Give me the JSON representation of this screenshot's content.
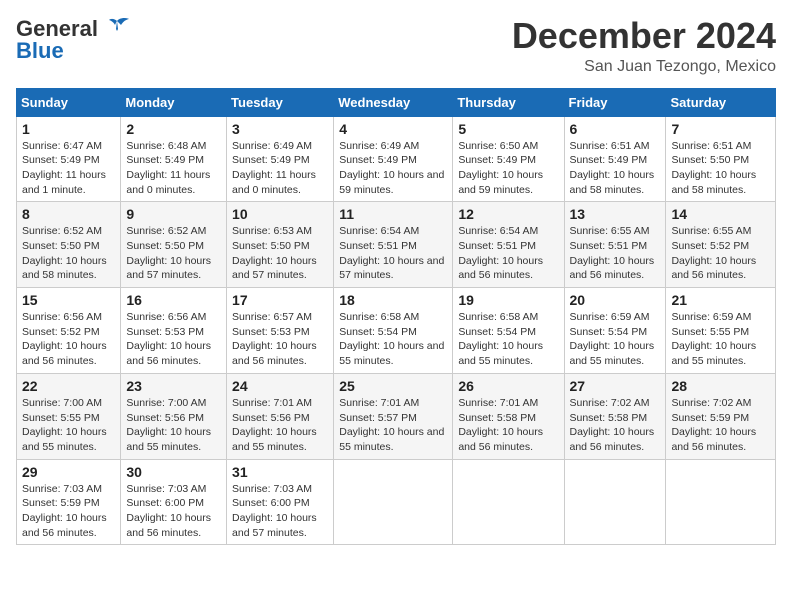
{
  "header": {
    "logo_general": "General",
    "logo_blue": "Blue",
    "month": "December 2024",
    "location": "San Juan Tezongo, Mexico"
  },
  "columns": [
    "Sunday",
    "Monday",
    "Tuesday",
    "Wednesday",
    "Thursday",
    "Friday",
    "Saturday"
  ],
  "weeks": [
    [
      {
        "day": "1",
        "sunrise": "6:47 AM",
        "sunset": "5:49 PM",
        "daylight": "11 hours and 1 minute."
      },
      {
        "day": "2",
        "sunrise": "6:48 AM",
        "sunset": "5:49 PM",
        "daylight": "11 hours and 0 minutes."
      },
      {
        "day": "3",
        "sunrise": "6:49 AM",
        "sunset": "5:49 PM",
        "daylight": "11 hours and 0 minutes."
      },
      {
        "day": "4",
        "sunrise": "6:49 AM",
        "sunset": "5:49 PM",
        "daylight": "10 hours and 59 minutes."
      },
      {
        "day": "5",
        "sunrise": "6:50 AM",
        "sunset": "5:49 PM",
        "daylight": "10 hours and 59 minutes."
      },
      {
        "day": "6",
        "sunrise": "6:51 AM",
        "sunset": "5:49 PM",
        "daylight": "10 hours and 58 minutes."
      },
      {
        "day": "7",
        "sunrise": "6:51 AM",
        "sunset": "5:50 PM",
        "daylight": "10 hours and 58 minutes."
      }
    ],
    [
      {
        "day": "8",
        "sunrise": "6:52 AM",
        "sunset": "5:50 PM",
        "daylight": "10 hours and 58 minutes."
      },
      {
        "day": "9",
        "sunrise": "6:52 AM",
        "sunset": "5:50 PM",
        "daylight": "10 hours and 57 minutes."
      },
      {
        "day": "10",
        "sunrise": "6:53 AM",
        "sunset": "5:50 PM",
        "daylight": "10 hours and 57 minutes."
      },
      {
        "day": "11",
        "sunrise": "6:54 AM",
        "sunset": "5:51 PM",
        "daylight": "10 hours and 57 minutes."
      },
      {
        "day": "12",
        "sunrise": "6:54 AM",
        "sunset": "5:51 PM",
        "daylight": "10 hours and 56 minutes."
      },
      {
        "day": "13",
        "sunrise": "6:55 AM",
        "sunset": "5:51 PM",
        "daylight": "10 hours and 56 minutes."
      },
      {
        "day": "14",
        "sunrise": "6:55 AM",
        "sunset": "5:52 PM",
        "daylight": "10 hours and 56 minutes."
      }
    ],
    [
      {
        "day": "15",
        "sunrise": "6:56 AM",
        "sunset": "5:52 PM",
        "daylight": "10 hours and 56 minutes."
      },
      {
        "day": "16",
        "sunrise": "6:56 AM",
        "sunset": "5:53 PM",
        "daylight": "10 hours and 56 minutes."
      },
      {
        "day": "17",
        "sunrise": "6:57 AM",
        "sunset": "5:53 PM",
        "daylight": "10 hours and 56 minutes."
      },
      {
        "day": "18",
        "sunrise": "6:58 AM",
        "sunset": "5:54 PM",
        "daylight": "10 hours and 55 minutes."
      },
      {
        "day": "19",
        "sunrise": "6:58 AM",
        "sunset": "5:54 PM",
        "daylight": "10 hours and 55 minutes."
      },
      {
        "day": "20",
        "sunrise": "6:59 AM",
        "sunset": "5:54 PM",
        "daylight": "10 hours and 55 minutes."
      },
      {
        "day": "21",
        "sunrise": "6:59 AM",
        "sunset": "5:55 PM",
        "daylight": "10 hours and 55 minutes."
      }
    ],
    [
      {
        "day": "22",
        "sunrise": "7:00 AM",
        "sunset": "5:55 PM",
        "daylight": "10 hours and 55 minutes."
      },
      {
        "day": "23",
        "sunrise": "7:00 AM",
        "sunset": "5:56 PM",
        "daylight": "10 hours and 55 minutes."
      },
      {
        "day": "24",
        "sunrise": "7:01 AM",
        "sunset": "5:56 PM",
        "daylight": "10 hours and 55 minutes."
      },
      {
        "day": "25",
        "sunrise": "7:01 AM",
        "sunset": "5:57 PM",
        "daylight": "10 hours and 55 minutes."
      },
      {
        "day": "26",
        "sunrise": "7:01 AM",
        "sunset": "5:58 PM",
        "daylight": "10 hours and 56 minutes."
      },
      {
        "day": "27",
        "sunrise": "7:02 AM",
        "sunset": "5:58 PM",
        "daylight": "10 hours and 56 minutes."
      },
      {
        "day": "28",
        "sunrise": "7:02 AM",
        "sunset": "5:59 PM",
        "daylight": "10 hours and 56 minutes."
      }
    ],
    [
      {
        "day": "29",
        "sunrise": "7:03 AM",
        "sunset": "5:59 PM",
        "daylight": "10 hours and 56 minutes."
      },
      {
        "day": "30",
        "sunrise": "7:03 AM",
        "sunset": "6:00 PM",
        "daylight": "10 hours and 56 minutes."
      },
      {
        "day": "31",
        "sunrise": "7:03 AM",
        "sunset": "6:00 PM",
        "daylight": "10 hours and 57 minutes."
      },
      null,
      null,
      null,
      null
    ]
  ]
}
